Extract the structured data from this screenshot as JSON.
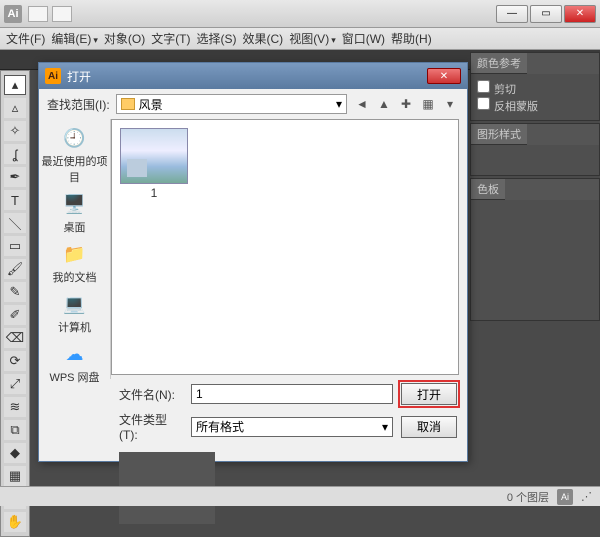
{
  "app": {
    "logo": "Ai",
    "window": {
      "minimize": "—",
      "maximize": "▭",
      "close": "✕"
    }
  },
  "menubar": {
    "file": "文件(F)",
    "edit": "编辑(E)",
    "object": "对象(O)",
    "type": "文字(T)",
    "select": "选择(S)",
    "effect": "效果(C)",
    "view": "视图(V)",
    "window": "窗口(W)",
    "help": "帮助(H)"
  },
  "panels": {
    "color_guide": "颜色参考",
    "clip": "剪切",
    "invert_mask": "反相蒙版",
    "styles": "图形样式",
    "swatches": "色板"
  },
  "dialog": {
    "title": "打开",
    "look_in_label": "查找范围(I):",
    "folder_name": "风景",
    "places": {
      "recent": "最近使用的项目",
      "desktop": "桌面",
      "documents": "我的文档",
      "computer": "计算机",
      "wps": "WPS 网盘"
    },
    "file_item_name": "1",
    "filename_label": "文件名(N):",
    "filename_value": "1",
    "filetype_label": "文件类型(T):",
    "filetype_value": "所有格式",
    "open_btn": "打开",
    "cancel_btn": "取消"
  },
  "status": {
    "selection": "0 个图层"
  },
  "icons": {
    "back": "◄",
    "up": "▲",
    "new": "✚",
    "view": "▦",
    "dropdown": "▾"
  }
}
